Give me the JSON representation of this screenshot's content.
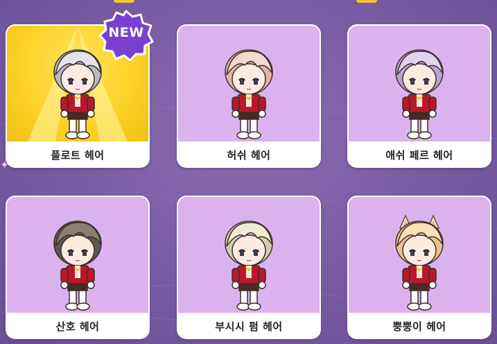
{
  "items": [
    {
      "label": "플로트 헤어",
      "hair": "#e3e3ea",
      "shade": "#b9b9c6",
      "ears": false,
      "selected": true
    },
    {
      "label": "허쉬 헤어",
      "hair": "#f6d8cf",
      "shade": "#e6b4a7",
      "ears": false,
      "selected": false
    },
    {
      "label": "애쉬 페르 헤어",
      "hair": "#e1d2ee",
      "shade": "#b9a2d2",
      "ears": false,
      "selected": false
    },
    {
      "label": "산호 헤어",
      "hair": "#8b7f72",
      "shade": "#5f564d",
      "ears": false,
      "selected": false
    },
    {
      "label": "부시시 펌 헤어",
      "hair": "#f1ecd6",
      "shade": "#d4ccad",
      "ears": false,
      "selected": false
    },
    {
      "label": "뿡뿡이 헤어",
      "hair": "#fbe0b8",
      "shade": "#eec28d",
      "ears": true,
      "selected": false
    }
  ],
  "badge": {
    "text": "NEW"
  },
  "colors": {
    "accent": "#f2c633",
    "card_art": "#dcb2ee",
    "badge": "#7a3fd0"
  }
}
